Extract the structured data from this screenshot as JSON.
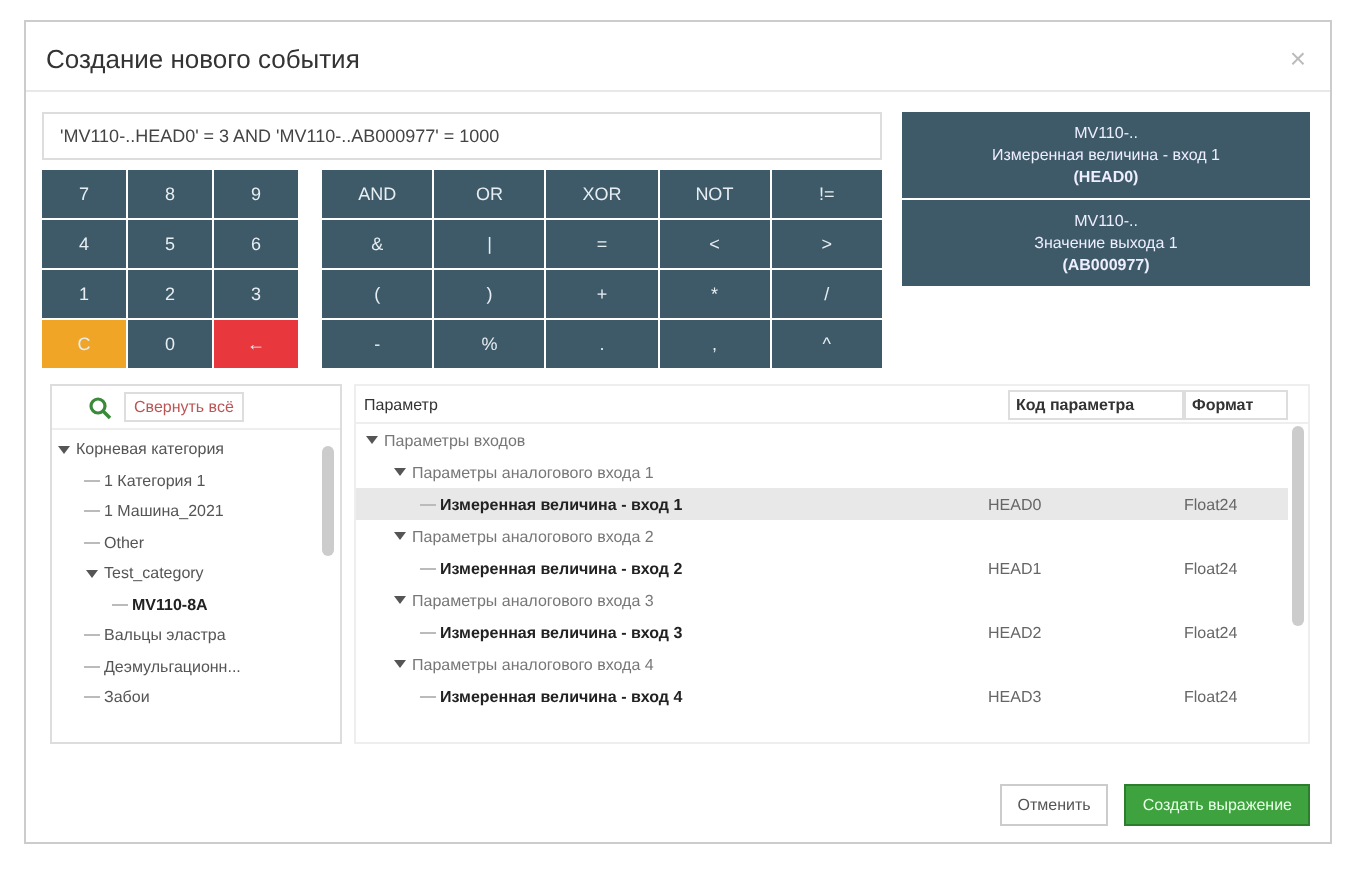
{
  "dialog": {
    "title": "Создание нового события",
    "close": "×"
  },
  "expression": {
    "value": "'MV110-..HEAD0' = 3 AND 'MV110-..AB000977' = 1000"
  },
  "keypad": [
    {
      "label": "7",
      "kind": "plain"
    },
    {
      "label": "8",
      "kind": "plain"
    },
    {
      "label": "9",
      "kind": "plain"
    },
    {
      "label": "4",
      "kind": "plain"
    },
    {
      "label": "5",
      "kind": "plain"
    },
    {
      "label": "6",
      "kind": "plain"
    },
    {
      "label": "1",
      "kind": "plain"
    },
    {
      "label": "2",
      "kind": "plain"
    },
    {
      "label": "3",
      "kind": "plain"
    },
    {
      "label": "C",
      "kind": "warn"
    },
    {
      "label": "0",
      "kind": "plain"
    },
    {
      "label": "←",
      "kind": "danger"
    }
  ],
  "operators": [
    "AND",
    "OR",
    "XOR",
    "NOT",
    "!=",
    "&",
    "|",
    "=",
    "<",
    ">",
    "(",
    ")",
    "+",
    "*",
    "/",
    "-",
    "%",
    ".",
    ",",
    "^"
  ],
  "variables": [
    {
      "device": "MV110-..",
      "name": "Измеренная величина - вход 1",
      "code": "(HEAD0)"
    },
    {
      "device": "MV110-..",
      "name": "Значение выхода 1",
      "code": "(AB000977)"
    }
  ],
  "tree": {
    "collapse_button": "Свернуть всё",
    "items": [
      {
        "label": "Корневая категория",
        "expanded": true,
        "selected": false,
        "children": [
          {
            "label": "1 Категория 1",
            "selected": false
          },
          {
            "label": "1 Машина_2021",
            "selected": false
          },
          {
            "label": "Other",
            "selected": false
          },
          {
            "label": "Test_category",
            "expanded": true,
            "selected": false,
            "children": [
              {
                "label": "MV110-8A",
                "selected": true
              }
            ]
          },
          {
            "label": "Вальцы эластра",
            "selected": false
          },
          {
            "label": "Деэмульгационн...",
            "selected": false
          },
          {
            "label": "Забои",
            "selected": false
          }
        ]
      }
    ]
  },
  "params": {
    "columns": [
      "Параметр",
      "Код параметра",
      "Формат"
    ],
    "rows": [
      {
        "label": "Параметры входов",
        "expanded": true,
        "children": [
          {
            "label": "Параметры аналогового входа 1",
            "expanded": true,
            "children": [
              {
                "label": "Измеренная величина - вход 1",
                "code": "HEAD0",
                "format": "Float24",
                "selected": true
              }
            ]
          },
          {
            "label": "Параметры аналогового входа 2",
            "expanded": true,
            "children": [
              {
                "label": "Измеренная величина - вход 2",
                "code": "HEAD1",
                "format": "Float24",
                "selected": false
              }
            ]
          },
          {
            "label": "Параметры аналогового входа 3",
            "expanded": true,
            "children": [
              {
                "label": "Измеренная величина - вход 3",
                "code": "HEAD2",
                "format": "Float24",
                "selected": false
              }
            ]
          },
          {
            "label": "Параметры аналогового входа 4",
            "expanded": true,
            "children": [
              {
                "label": "Измеренная величина - вход 4",
                "code": "HEAD3",
                "format": "Float24",
                "selected": false
              }
            ]
          }
        ]
      }
    ]
  },
  "buttons": [
    {
      "label": "Отменить",
      "kind": "secondary"
    },
    {
      "label": "Создать выражение",
      "kind": "primary"
    }
  ]
}
